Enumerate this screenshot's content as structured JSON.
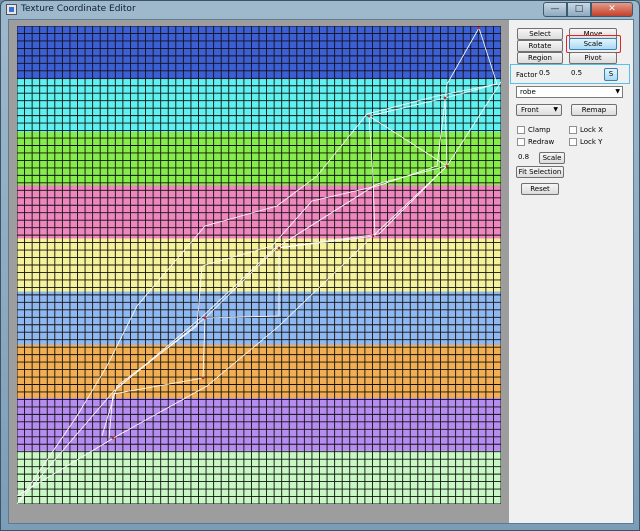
{
  "window": {
    "title": "Texture Coordinate Editor",
    "min_icon": "minimize-icon",
    "max_icon": "maximize-icon",
    "close_icon": "close-icon"
  },
  "canvas": {
    "bands": [
      "#3d5fd6",
      "#5ff0f0",
      "#86ec4a",
      "#ef86c0",
      "#f6f29a",
      "#8fb8f0",
      "#f2ae52",
      "#b68cf0",
      "#c8f8c4"
    ],
    "grid_color": "#111111",
    "overlay_color": "#ffffff"
  },
  "tools": {
    "select": "Select",
    "move": "Move",
    "rotate": "Rotate",
    "scale": "Scale",
    "region": "Region",
    "pivot": "Pivot"
  },
  "factor": {
    "label": "Factor",
    "x": "0.5",
    "y": "0.5",
    "apply": "S"
  },
  "object_combo": {
    "value": "robe"
  },
  "projection": {
    "value": "Front",
    "remap": "Remap"
  },
  "options": {
    "clamp": "Clamp",
    "lock_x": "Lock X",
    "redraw": "Redraw",
    "lock_y": "Lock Y"
  },
  "scale_value": "0.8",
  "scale_button": "Scale",
  "fit_selection": "Fit Selection",
  "reset": "Reset"
}
